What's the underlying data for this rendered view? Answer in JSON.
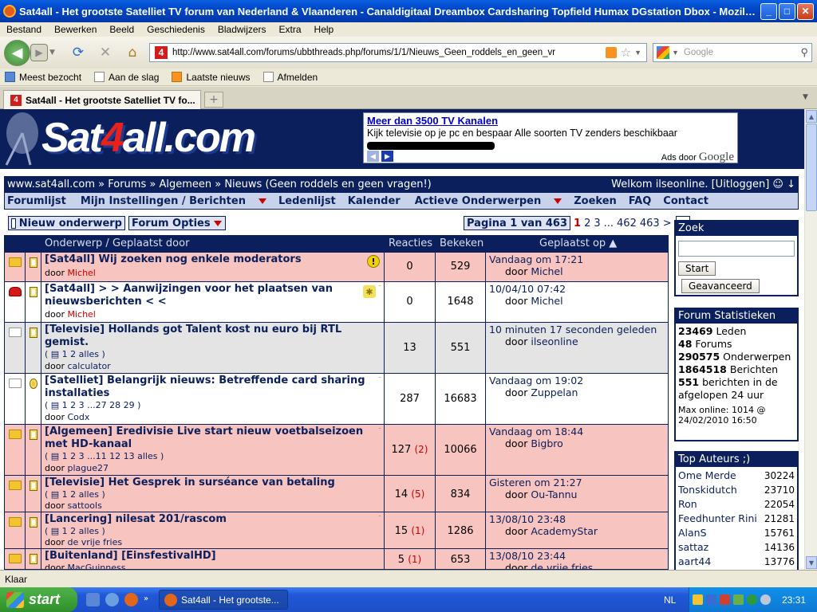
{
  "window": {
    "title": "Sat4all - Het grootste Satelliet TV forum van Nederland & Vlaanderen - Canaldigitaal Dreambox Cardsharing Topfield Humax DGstation Dbox - Mozill...",
    "controls": {
      "minimize": "_",
      "maximize": "□",
      "close": "✕"
    }
  },
  "menubar": [
    "Bestand",
    "Bewerken",
    "Beeld",
    "Geschiedenis",
    "Bladwijzers",
    "Extra",
    "Help"
  ],
  "toolbar": {
    "url": "http://www.sat4all.com/forums/ubbthreads.php/forums/1/1/Nieuws_Geen_roddels_en_geen_vr",
    "search_placeholder": "Google",
    "back_icon": "◀",
    "forward_icon": "▶",
    "reload_icon": "⟳",
    "stop_icon": "✕",
    "home_icon": "⌂"
  },
  "bookmarks": [
    "Meest bezocht",
    "Aan de slag",
    "Laatste nieuws",
    "Afmelden"
  ],
  "tabs": [
    {
      "label": "Sat4all - Het grootste Satelliet TV fo..."
    }
  ],
  "newtab_label": "+",
  "site": {
    "logo": "Sat4all.com",
    "ad": {
      "title": "Meer dan 3500 TV Kanalen",
      "text": "Kijk televisie op je pc en bespaar Alle soorten TV zenders beschikbaar",
      "by_prefix": "Ads door",
      "by_brand": "Google"
    },
    "breadcrumb": "www.sat4all.com » Forums » Algemeen » Nieuws (Geen roddels en geen vragen!)",
    "welcome": "Welkom ilseonline. [Uitloggen] ☺ ↓",
    "nav": [
      "Forumlijst",
      "Mijn Instellingen / Berichten",
      "Ledenlijst",
      "Kalender",
      "Actieve Onderwerpen",
      "Zoeken",
      "FAQ",
      "Contact"
    ],
    "new_topic": "Nieuw onderwerp",
    "forum_options": "Forum Opties",
    "pager": {
      "label": "Pagina 1 van 463",
      "current": "1",
      "pages": [
        "2",
        "3",
        "...",
        "462",
        "463",
        ">"
      ]
    }
  },
  "table": {
    "headers": {
      "subject": "Onderwerp / Geplaatst door",
      "replies": "Reacties",
      "views": "Bekeken",
      "posted": "Geplaatst op ▲"
    },
    "rows": [
      {
        "subject": "[Sat4all] Wij zoeken nog enkele moderators",
        "pages": "",
        "by_label": "door",
        "by": "Michel",
        "replies": "0",
        "replies_new": "",
        "views": "529",
        "date": "Vandaag om 17:21",
        "last_by": "Michel"
      },
      {
        "subject": "[Sat4all] > > Aanwijzingen voor het plaatsen van nieuwsberichten < <",
        "pages": "",
        "by_label": "door",
        "by": "Michel",
        "replies": "0",
        "replies_new": "",
        "views": "1648",
        "date": "10/04/10 07:42",
        "last_by": "Michel"
      },
      {
        "subject": "[Televisie] Hollands got Talent kost nu euro bij RTL gemist.",
        "pages": "( ▤ 1 2 alles )",
        "by_label": "door",
        "by": "calculator",
        "replies": "13",
        "replies_new": "",
        "views": "551",
        "date": "10 minuten 17 seconden geleden",
        "last_by": "ilseonline"
      },
      {
        "subject": "[Satelliet] Belangrijk nieuws: Betreffende card sharing installaties",
        "pages": "( ▤ 1 2 3 ...27 28 29 )",
        "by_label": "door",
        "by": "Codx",
        "replies": "287",
        "replies_new": "",
        "views": "16683",
        "date": "Vandaag om 19:02",
        "last_by": "Zuppelan"
      },
      {
        "subject": "[Algemeen] Eredivisie Live start nieuw voetbalseizoen met HD-kanaal",
        "pages": "( ▤ 1 2 3 ...11 12 13 alles )",
        "by_label": "door",
        "by": "plague27",
        "replies": "127",
        "replies_new": "(2)",
        "views": "10066",
        "date": "Vandaag om 18:44",
        "last_by": "Bigbro"
      },
      {
        "subject": "[Televisie] Het Gesprek in surséance van betaling",
        "pages": "( ▤ 1 2 alles )",
        "by_label": "door",
        "by": "sattools",
        "replies": "14",
        "replies_new": "(5)",
        "views": "834",
        "date": "Gisteren om 21:27",
        "last_by": "Ou-Tannu"
      },
      {
        "subject": "[Lancering] nilesat 201/rascom",
        "pages": "( ▤ 1 2 alles )",
        "by_label": "door",
        "by": "de vrije fries",
        "replies": "15",
        "replies_new": "(1)",
        "views": "1286",
        "date": "13/08/10 23:48",
        "last_by": "AcademyStar"
      },
      {
        "subject": "[Buitenland] [EinsfestivalHD]",
        "pages": "",
        "by_label": "door",
        "by": "MacGuinness",
        "replies": "5",
        "replies_new": "(1)",
        "views": "653",
        "date": "13/08/10 23:44",
        "last_by": "de vrije fries"
      }
    ]
  },
  "sidebar": {
    "search": {
      "title": "Zoek",
      "button": "Start",
      "advanced": "Geavanceerd"
    },
    "stats": {
      "title": "Forum Statistieken",
      "members": "23469",
      "members_label": "Leden",
      "forums": "48",
      "forums_label": "Forums",
      "topics": "290575",
      "topics_label": "Onderwerpen",
      "posts": "1864518",
      "posts_label": "Berichten",
      "recent": "551",
      "recent_label": "berichten in de afgelopen 24 uur",
      "max_online": "Max online: 1014 @ 24/02/2010 16:50"
    },
    "authors": {
      "title": "Top Auteurs ;)",
      "list": [
        {
          "name": "Ome Merde",
          "count": "30224"
        },
        {
          "name": "Tonskidutch",
          "count": "23710"
        },
        {
          "name": "Ron",
          "count": "22054"
        },
        {
          "name": "Feedhunter Rini",
          "count": "21281"
        },
        {
          "name": "AlanS",
          "count": "15761"
        },
        {
          "name": "sattaz",
          "count": "14136"
        },
        {
          "name": "aart44",
          "count": "13776"
        }
      ]
    }
  },
  "status": "Klaar",
  "taskbar": {
    "start": "start",
    "item": "Sat4all - Het grootste...",
    "lang": "NL",
    "clock": "23:31"
  }
}
